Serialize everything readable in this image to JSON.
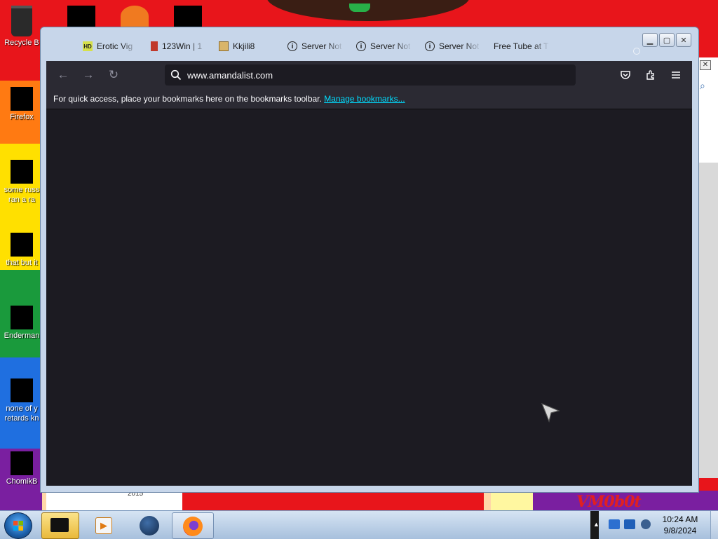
{
  "desktop": {
    "icons": [
      {
        "label": "Recycle B"
      },
      {
        "label": "Firefox"
      },
      {
        "label": "some russ",
        "label2": "ran a ra"
      },
      {
        "label": "that but it"
      },
      {
        "label": "Enderman"
      },
      {
        "label": "none of y",
        "label2": "retards kn"
      },
      {
        "label": "ChomikB"
      }
    ],
    "watermark": "VM0b0t",
    "year_text": "2015"
  },
  "browser": {
    "tabs": [
      {
        "icon": "hd-icon",
        "label": "Erotic Vig"
      },
      {
        "icon": "video-icon",
        "label": "123Win | 1"
      },
      {
        "icon": "box-icon",
        "label": "Kkjili8"
      },
      {
        "icon": "info-icon",
        "label": "Server Not"
      },
      {
        "icon": "info-icon",
        "label": "Server Not"
      },
      {
        "icon": "info-icon",
        "label": "Server Not"
      },
      {
        "icon": "none",
        "label": "Free Tube at T"
      }
    ],
    "url": "www.amandalist.com",
    "bookmarks_message": "For quick access, place your bookmarks here on the bookmarks toolbar.",
    "manage_bookmarks": "Manage bookmarks..."
  },
  "taskbar": {
    "clock_time": "10:24 AM",
    "clock_date": "9/8/2024"
  }
}
